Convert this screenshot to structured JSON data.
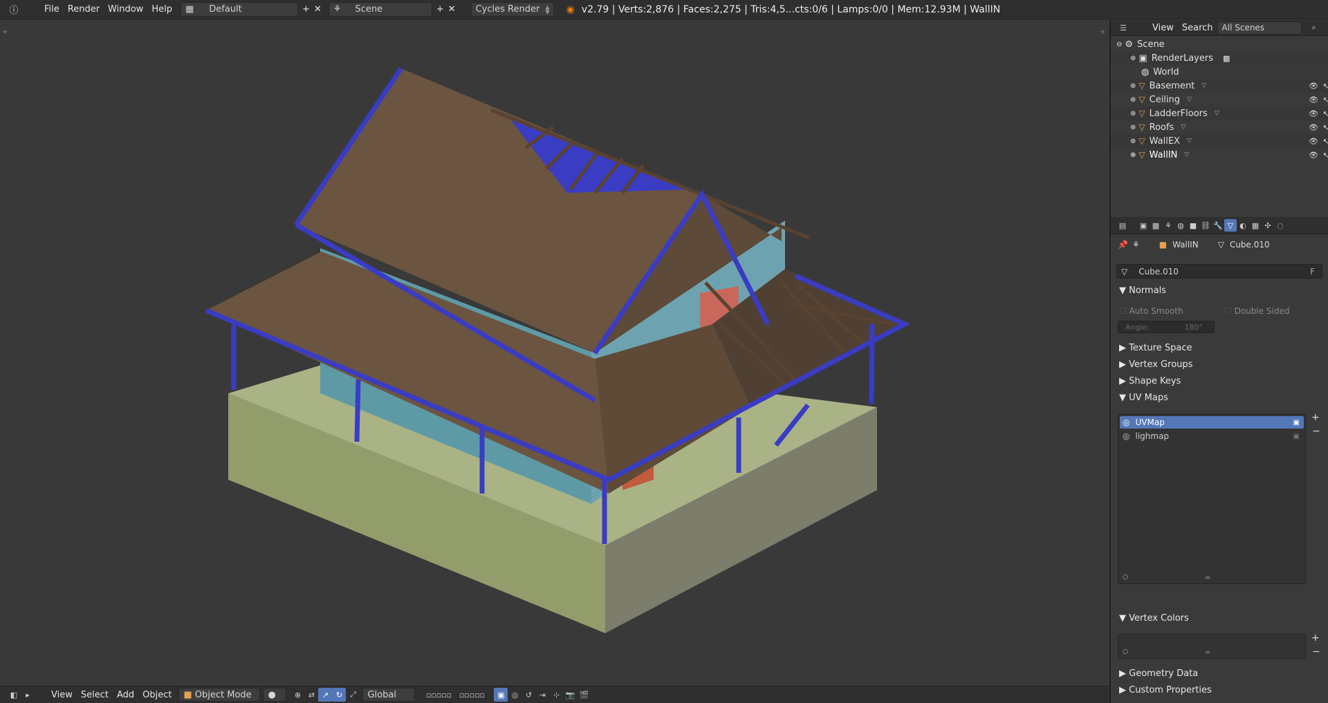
{
  "topbar": {
    "menus": [
      "File",
      "Render",
      "Window",
      "Help"
    ],
    "layout": "Default",
    "scene": "Scene",
    "engine": "Cycles Render",
    "status": "v2.79 | Verts:2,876 | Faces:2,275 | Tris:4,5...cts:0/6 | Lamps:0/0 | Mem:12.93M | WallIN"
  },
  "viewport": {
    "bottom_menus": [
      "View",
      "Select",
      "Add",
      "Object"
    ],
    "mode": "Object Mode",
    "orientation": "Global"
  },
  "outliner": {
    "menus": [
      "View",
      "Search"
    ],
    "display": "All Scenes",
    "items": [
      {
        "name": "Scene"
      },
      {
        "name": "RenderLayers"
      },
      {
        "name": "World"
      },
      {
        "name": "Basement"
      },
      {
        "name": "Ceiling"
      },
      {
        "name": "LadderFloors"
      },
      {
        "name": "Roofs"
      },
      {
        "name": "WallEX"
      },
      {
        "name": "WallIN"
      }
    ]
  },
  "properties": {
    "object": "WallIN",
    "mesh": "Cube.010",
    "mesh_field": "Cube.010",
    "fake_user": "F",
    "normals": {
      "title": "Normals",
      "auto_smooth": "Auto Smooth",
      "double_sided": "Double Sided",
      "angle_label": "Angle:",
      "angle_value": "180°"
    },
    "sections": [
      "Texture Space",
      "Vertex Groups",
      "Shape Keys"
    ],
    "uv_maps": {
      "title": "UV Maps",
      "items": [
        "UVMap",
        "lighmap"
      ]
    },
    "vertex_colors": "Vertex Colors",
    "bottom_sections": [
      "Geometry Data",
      "Custom Properties"
    ]
  },
  "colors": {
    "roof": "#6b5540",
    "wall": "#5e9aa6",
    "base_top": "#a9b386",
    "base_left": "#939d6c",
    "base_right": "#7d7d6c",
    "beam": "#3a3cc4",
    "selection": "#5477b8"
  }
}
